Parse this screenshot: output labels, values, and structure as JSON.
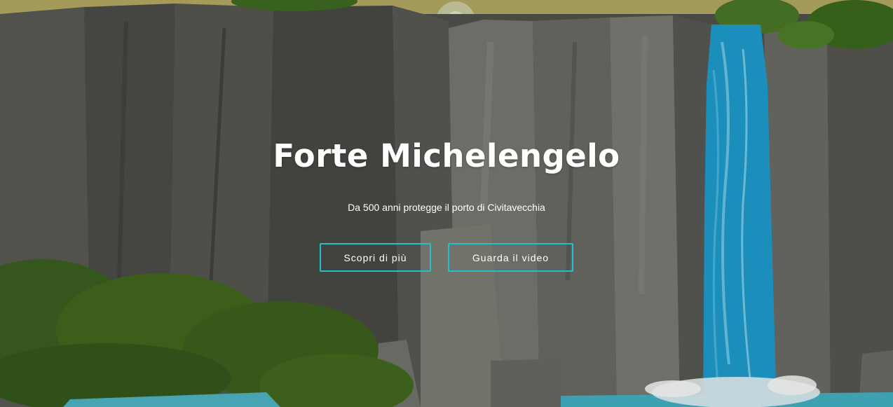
{
  "hero": {
    "title": "Forte Michelengelo",
    "subtitle": "Da 500 anni protegge il porto di Civitavecchia",
    "buttons": {
      "more_label": "Scopri di più",
      "video_label": "Guarda il video"
    }
  },
  "colors": {
    "accent": "#1bc4cc",
    "sky": "#b9b16a",
    "cliff": "#6b6a63",
    "waterfall": "#1ea3d4",
    "foliage": "#3d6a1e"
  },
  "background": {
    "illustration": "cartoon-waterfall-cliffs"
  }
}
